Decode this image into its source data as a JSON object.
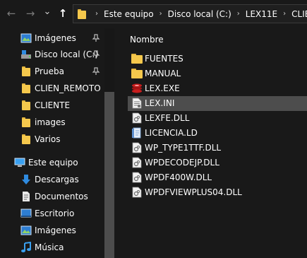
{
  "nav_buttons": {
    "back": "←",
    "forward": "→",
    "recent": "⌄",
    "up": "↑"
  },
  "address": {
    "crumbs": [
      "Este equipo",
      "Disco local (C:)",
      "LEX11E",
      "CLIENTE"
    ],
    "separator": "›"
  },
  "sidebar": {
    "quick_access": [
      {
        "label": "Imágenes",
        "icon": "pictures-icon",
        "pinned": true
      },
      {
        "label": "Disco local (C:)",
        "icon": "drive-icon",
        "pinned": true
      },
      {
        "label": "Prueba",
        "icon": "folder-icon",
        "pinned": true
      },
      {
        "label": "CLIEN_REMOTO",
        "icon": "folder-icon",
        "pinned": false
      },
      {
        "label": "CLIENTE",
        "icon": "folder-icon",
        "pinned": false
      },
      {
        "label": "images",
        "icon": "folder-icon",
        "pinned": false
      },
      {
        "label": "Varios",
        "icon": "folder-icon",
        "pinned": false
      }
    ],
    "this_pc": {
      "label": "Este equipo",
      "icon": "computer-icon"
    },
    "pc_items": [
      {
        "label": "Descargas",
        "icon": "downloads-icon"
      },
      {
        "label": "Documentos",
        "icon": "documents-icon"
      },
      {
        "label": "Escritorio",
        "icon": "desktop-icon"
      },
      {
        "label": "Imágenes",
        "icon": "pictures-icon"
      },
      {
        "label": "Música",
        "icon": "music-icon"
      }
    ]
  },
  "content": {
    "column_header": "Nombre",
    "files": [
      {
        "name": "FUENTES",
        "icon": "folder-icon",
        "selected": false
      },
      {
        "name": "MANUAL",
        "icon": "folder-icon",
        "selected": false
      },
      {
        "name": "LEX.EXE",
        "icon": "exe-icon",
        "selected": false
      },
      {
        "name": "LEX.INI",
        "icon": "ini-file-icon",
        "selected": true
      },
      {
        "name": "LEXFE.DLL",
        "icon": "dll-file-icon",
        "selected": false
      },
      {
        "name": "LICENCIA.LD",
        "icon": "ld-file-icon",
        "selected": false
      },
      {
        "name": "WP_TYPE1TTF.DLL",
        "icon": "dll-file-icon",
        "selected": false
      },
      {
        "name": "WPDECODEJP.DLL",
        "icon": "dll-file-icon",
        "selected": false
      },
      {
        "name": "WPDF400W.DLL",
        "icon": "dll-file-icon",
        "selected": false
      },
      {
        "name": "WPDFVIEWPLUS04.DLL",
        "icon": "dll-file-icon",
        "selected": false
      }
    ]
  }
}
